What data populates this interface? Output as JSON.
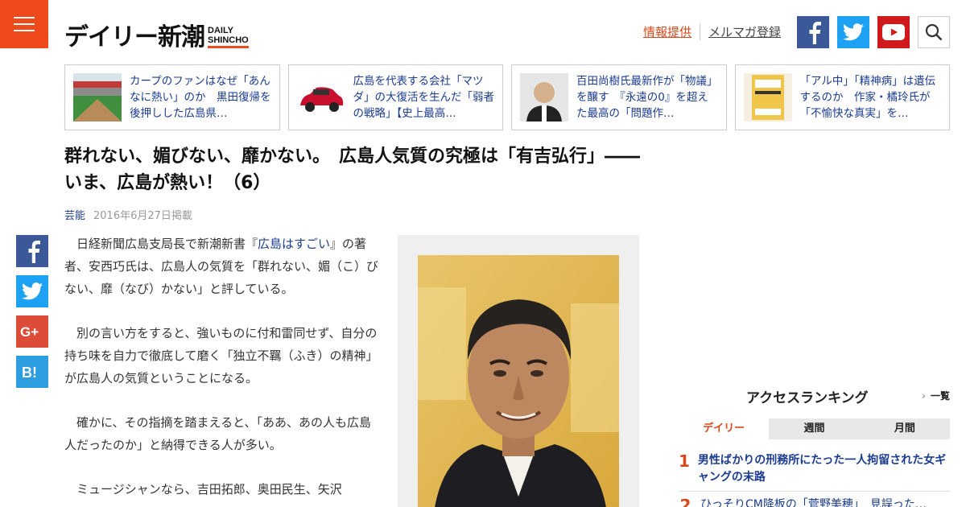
{
  "header": {
    "logo_jp": "デイリー新潮",
    "logo_en_top": "DAILY",
    "logo_en_bottom": "SHINCHO",
    "link_info": "情報提供",
    "link_mail": "メルマガ登録",
    "icons": [
      "menu-icon",
      "facebook-icon",
      "twitter-icon",
      "youtube-icon",
      "search-icon"
    ]
  },
  "related": [
    {
      "text": "カープのファンはなぜ「あんなに熱い」のか　黒田復帰を後押しした広島県…"
    },
    {
      "text": "広島を代表する会社「マツダ」の大復活を生んだ「弱者の戦略」【史上最高…"
    },
    {
      "text": "百田尚樹氏最新作が「物議」を醸す　『永遠の0』を超えた最高の「問題作…"
    },
    {
      "text": "「アル中」「精神病」は遺伝するのか　作家・橘玲氏が「不愉快な真実」を…"
    }
  ],
  "article": {
    "title": "群れない、媚びない、靡かない。　広島人気質の究極は「有吉弘行」――いま、広島が熱い！（6）",
    "category": "芸能",
    "date": "2016年6月27日掲載",
    "p1_pre": "日経新聞広島支局長で新潮新書『",
    "p1_link": "広島はすごい",
    "p1_post": "』の著者、安西巧氏は、広島人の気質を「群れない、媚（こ）びない、靡（なび）かない」と評している。",
    "p2": "別の言い方をすると、強いものに付和雷同せず、自分の持ち味を自力で徹底して磨く「独立不羈（ふき）の精神」が広島人の気質ということになる。",
    "p3": "確かに、その指摘を踏まえると、「ああ、あの人も広島人だったのか」と納得できる人が多い。",
    "p4": "ミュージシャンなら、吉田拓郎、奥田民生、矢沢"
  },
  "share_icons": [
    "facebook-icon",
    "twitter-icon",
    "google-plus-icon",
    "hatena-bookmark-icon"
  ],
  "ranking": {
    "title": "アクセスランキング",
    "all_label": "一覧",
    "tabs": [
      "デイリー",
      "週間",
      "月間"
    ],
    "active_tab": 0,
    "items": [
      {
        "rank": "1",
        "text": "男性ばかりの刑務所にたった一人拘留された女ギャングの末路"
      },
      {
        "rank": "2",
        "text": "ひっそりCM降板の「菅野美穂」　見誤った…"
      }
    ]
  },
  "colors": {
    "brand": "#f04a1c",
    "link": "#1a3b8f",
    "accent_text": "#d9481b"
  }
}
